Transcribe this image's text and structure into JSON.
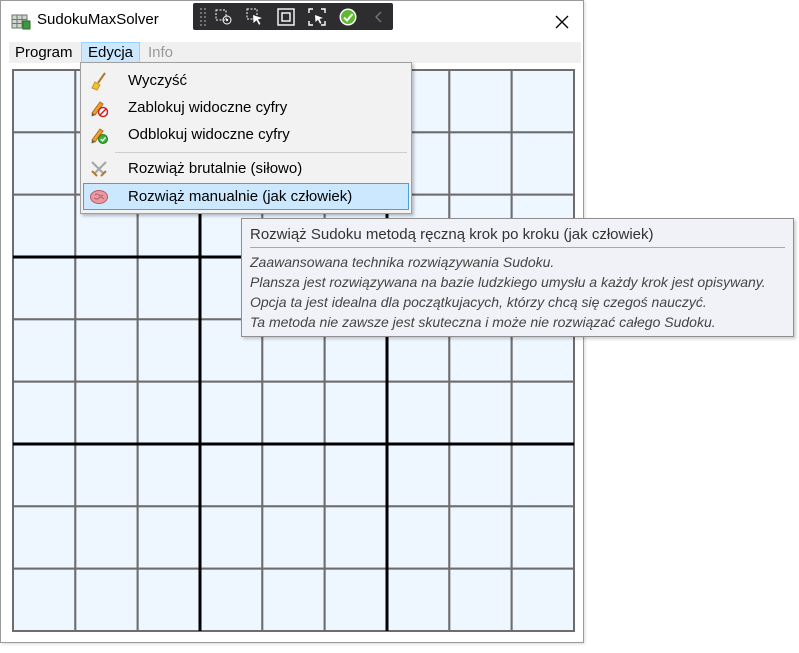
{
  "window": {
    "title": "SudokuMaxSolver",
    "close_glyph": "✕"
  },
  "menubar": [
    {
      "label": "Program",
      "state": "normal"
    },
    {
      "label": "Edycja",
      "state": "open"
    },
    {
      "label": "Info",
      "state": "disabled"
    }
  ],
  "dropdown": {
    "items": [
      {
        "label": "Wyczyść",
        "icon": "broom-icon"
      },
      {
        "label": "Zablokuj widoczne cyfry",
        "icon": "lock-pencil-icon"
      },
      {
        "label": "Odblokuj widoczne cyfry",
        "icon": "unlock-pencil-icon"
      },
      {
        "label": "Rozwiąż brutalnie (siłowo)",
        "icon": "crossed-swords-icon"
      },
      {
        "label": "Rozwiąż manualnie (jak człowiek)",
        "icon": "brain-icon",
        "selected": true
      }
    ]
  },
  "tooltip": {
    "title": "Rozwiąż Sudoku metodą ręczną krok po kroku (jak człowiek)",
    "lines": [
      "Zaawansowana technika rozwiązywania Sudoku.",
      "Plansza jest rozwiązywana na bazie ludzkiego umysłu a każdy krok jest opisywany.",
      "Opcja ta jest idealna dla początkujacych, którzy chcą się czegoś nauczyć.",
      "Ta metoda nie zawsze jest skuteczna i może nie rozwiązać całego Sudoku."
    ]
  },
  "debug_toolbar": {
    "tools": [
      "select-element-icon",
      "pointer-select-icon",
      "layout-adorner-icon",
      "track-focus-icon",
      "hot-reload-ok-icon",
      "collapse-chevron-icon"
    ]
  },
  "board": {
    "rows": 9,
    "cols": 9,
    "box_size": 3
  },
  "colors": {
    "cell_fill": "#eef6ff",
    "thin_line": "#6d6d6d",
    "thick_line": "#000000",
    "menu_highlight": "#cce8ff",
    "menu_highlight_border": "#4a9fd8"
  }
}
